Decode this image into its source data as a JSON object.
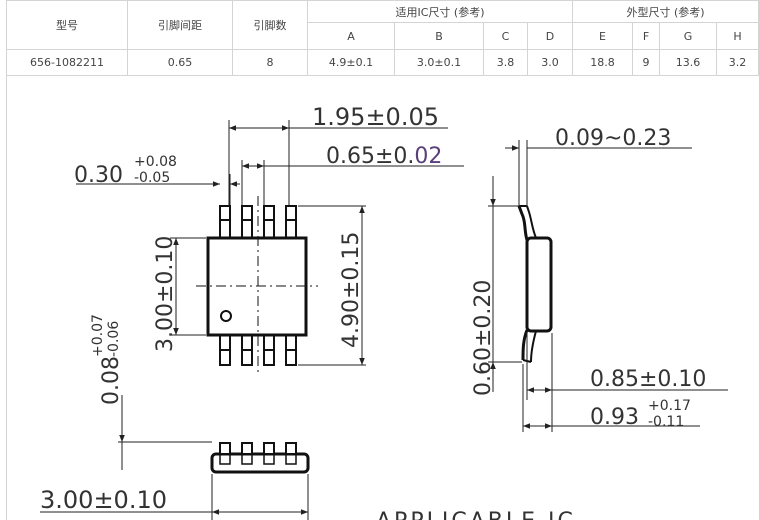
{
  "table": {
    "headers": {
      "model": "型号",
      "pin_pitch": "引脚间距",
      "pin_count": "引脚数",
      "ic_size_group": "适用IC尺寸 (参考)",
      "outline_group": "外型尺寸 (参考)",
      "cols": [
        "A",
        "B",
        "C",
        "D",
        "E",
        "F",
        "G",
        "H"
      ]
    },
    "row": {
      "model": "656-1082211",
      "pin_pitch": "0.65",
      "pin_count": "8",
      "cells": [
        "4.9±0.1",
        "3.0±0.1",
        "3.8",
        "3.0",
        "18.8",
        "9",
        "13.6",
        "3.2"
      ]
    }
  },
  "drawing": {
    "dim_195": "1.95±0.05",
    "dim_065": "0.65±0.02",
    "dim_030_base": "0.30",
    "dim_030_upper": "+0.08",
    "dim_030_lower": "-0.05",
    "dim_300_vertical": "3.00±0.10",
    "dim_490_vertical": "4.90±0.15",
    "dim_008_base": "0.08",
    "dim_008_upper": "+0.07",
    "dim_008_lower": "-0.06",
    "dim_300_bottom": "3.00±0.10",
    "dim_009": "0.09~0.23",
    "dim_060": "0.60±0.20",
    "dim_085": "0.85±0.10",
    "dim_093_base": "0.93",
    "dim_093_upper": "+0.17",
    "dim_093_lower": "-0.11",
    "footer_text": "APPLICABLE IC",
    "accent_color": "#5a3f7a"
  }
}
